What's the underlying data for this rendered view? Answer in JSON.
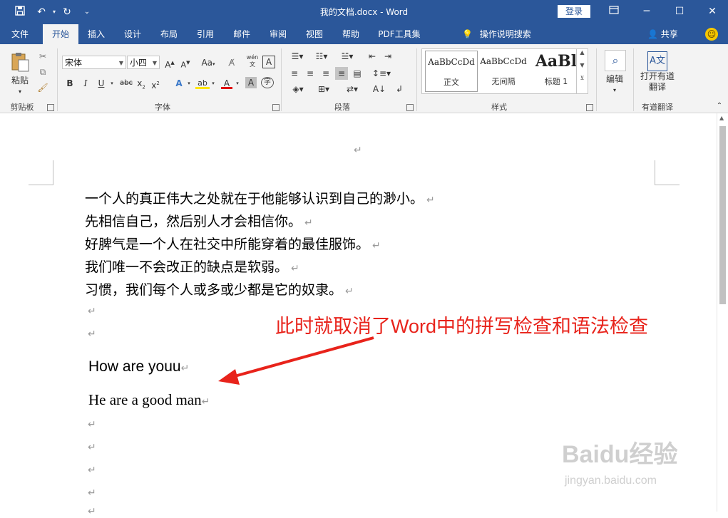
{
  "app": {
    "title": "我的文档.docx - Word",
    "login_label": "登录",
    "qa_save_icon": "save-icon",
    "qa_undo_icon": "undo-icon",
    "qa_redo_icon": "redo-icon",
    "qa_customize_icon": "customize-qa-icon",
    "accent_color": "#2b579a"
  },
  "tabs": [
    "文件",
    "开始",
    "插入",
    "设计",
    "布局",
    "引用",
    "邮件",
    "审阅",
    "视图",
    "帮助",
    "PDF工具集"
  ],
  "active_tab": "开始",
  "tell_me": "操作说明搜索",
  "share": "共享",
  "ribbon": {
    "clipboard": {
      "label": "剪贴板",
      "paste": "粘贴"
    },
    "font": {
      "label": "字体",
      "font_name": "宋体",
      "font_size": "小四",
      "change_case": "Aa",
      "phonetic": "wén"
    },
    "paragraph": {
      "label": "段落"
    },
    "styles": {
      "label": "样式",
      "items": [
        {
          "sample": "AaBbCcDd",
          "name": "正文"
        },
        {
          "sample": "AaBbCcDd",
          "name": "无间隔"
        },
        {
          "sample": "AaBl",
          "name": "标题 1"
        }
      ]
    },
    "editing": {
      "label": "编辑"
    },
    "translate": {
      "label": "有道翻译",
      "button": "打开有道翻译"
    }
  },
  "document": {
    "lines": [
      "一个人的真正伟大之处就在于他能够认识到自己的渺小。",
      "先相信自己，然后别人才会相信你。",
      "好脾气是一个人在社交中所能穿着的最佳服饰。",
      "我们唯一不会改正的缺点是软弱。",
      "习惯，我们每个人或多或少都是它的奴隶。",
      "",
      "",
      "How are youu",
      "He are a good man",
      "",
      "",
      "",
      "",
      ""
    ],
    "paragraph_mark": "↵",
    "annotation": "此时就取消了Word中的拼写检查和语法检查",
    "annotation_color": "#e8231b"
  },
  "watermark": {
    "main": "Baidu经验",
    "sub": "jingyan.baidu.com"
  }
}
